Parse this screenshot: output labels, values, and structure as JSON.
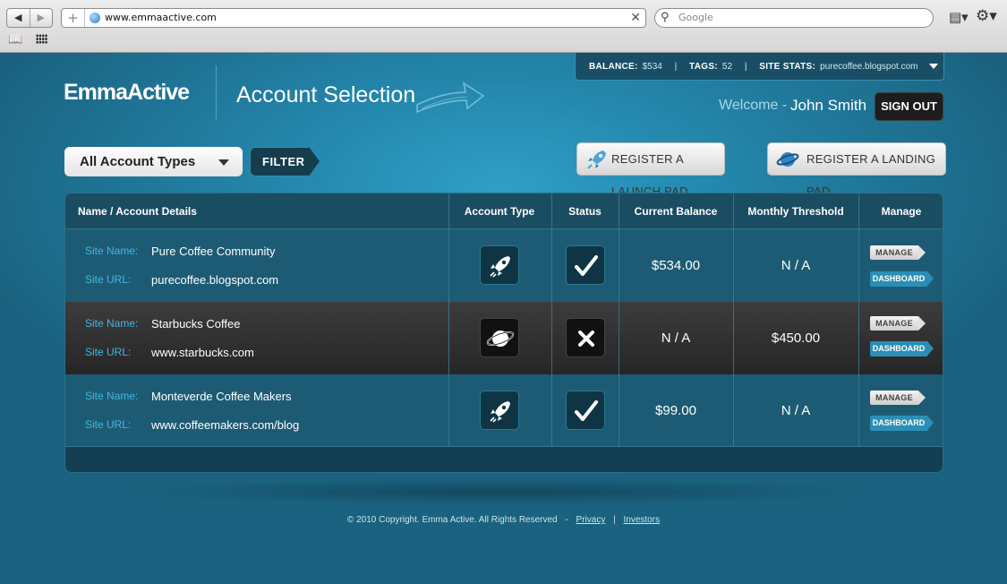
{
  "browser": {
    "url": "www.emmaactive.com",
    "search_placeholder": "Google"
  },
  "topstats": {
    "balance_label": "BALANCE:",
    "balance_value": "$534",
    "tags_label": "TAGS:",
    "tags_value": "52",
    "site_stats_label": "SITE STATS:",
    "site_stats_value": "purecoffee.blogspot.com"
  },
  "header": {
    "logo": "EmmaActive",
    "title": "Account Selection",
    "welcome": "Welcome -",
    "username": "John Smith",
    "signout": "SIGN OUT"
  },
  "toolbar": {
    "account_type_selected": "All Account Types",
    "filter": "FILTER",
    "register_launch": "REGISTER A LAUNCH PAD",
    "register_landing": "REGISTER A LANDING PAD"
  },
  "table": {
    "headers": [
      "Name / Account Details",
      "Account Type",
      "Status",
      "Current Balance",
      "Monthly Threshold",
      "Manage"
    ],
    "site_name_label": "Site Name:",
    "site_url_label": "Site URL:",
    "manage_label": "MANAGE",
    "dashboard_label": "DASHBOARD",
    "rows": [
      {
        "site_name": "Pure Coffee Community",
        "site_url": "purecoffee.blogspot.com",
        "account_type": "rocket-icon",
        "status": "check",
        "balance": "$534.00",
        "threshold": "N / A"
      },
      {
        "site_name": "Starbucks Coffee",
        "site_url": "www.starbucks.com",
        "account_type": "planet-icon",
        "status": "cross",
        "balance": "N / A",
        "threshold": "$450.00"
      },
      {
        "site_name": "Monteverde Coffee Makers",
        "site_url": "www.coffeemakers.com/blog",
        "account_type": "rocket-icon",
        "status": "check",
        "balance": "$99.00",
        "threshold": "N / A"
      }
    ]
  },
  "footer": {
    "copyright": "© 2010 Copyright. Emma Active. All Rights Reserved",
    "separator": "-",
    "privacy": "Privacy",
    "pipe": "|",
    "investors": "Investors"
  },
  "colors": {
    "accent_blue": "#2a8fb6",
    "label_blue": "#43b6e0",
    "background": "#2383a8"
  }
}
